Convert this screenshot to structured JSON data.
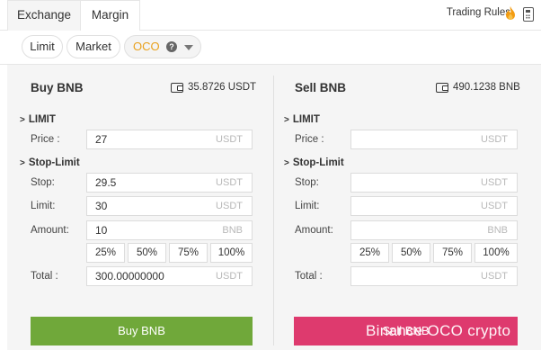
{
  "tabs": {
    "exchange": "Exchange",
    "margin": "Margin"
  },
  "header": {
    "trading_rules": "Trading Rules"
  },
  "order_types": {
    "limit": "Limit",
    "market": "Market",
    "oco": "OCO",
    "help": "?"
  },
  "buy": {
    "title": "Buy BNB",
    "balance": "35.8726 USDT",
    "limit_section": "LIMIT",
    "price_label": "Price :",
    "price_value": "27",
    "price_unit": "USDT",
    "stop_limit_section": "Stop-Limit",
    "stop_label": "Stop:",
    "stop_value": "29.5",
    "stop_unit": "USDT",
    "limit_label": "Limit:",
    "limit_value": "30",
    "limit_unit": "USDT",
    "amount_label": "Amount:",
    "amount_value": "10",
    "amount_unit": "BNB",
    "percentages": [
      "25%",
      "50%",
      "75%",
      "100%"
    ],
    "total_label": "Total :",
    "total_value": "300.00000000",
    "total_unit": "USDT",
    "button": "Buy BNB"
  },
  "sell": {
    "title": "Sell BNB",
    "balance": "490.1238 BNB",
    "limit_section": "LIMIT",
    "price_label": "Price :",
    "price_unit": "USDT",
    "stop_limit_section": "Stop-Limit",
    "stop_label": "Stop:",
    "stop_unit": "USDT",
    "limit_label": "Limit:",
    "limit_unit": "USDT",
    "amount_label": "Amount:",
    "amount_unit": "BNB",
    "percentages": [
      "25%",
      "50%",
      "75%",
      "100%"
    ],
    "total_label": "Total :",
    "total_unit": "USDT",
    "button": "Sell BNB"
  },
  "watermark": "Binance OCO crypto",
  "colors": {
    "buy": "#70a83a",
    "sell": "#de3a6e",
    "oco_accent": "#e9a11d",
    "fire": "#f39c12"
  },
  "icons": {
    "fire": "fire-icon",
    "calculator": "calculator-icon",
    "wallet": "wallet-icon",
    "help": "help-icon",
    "caret": "caret-down-icon",
    "chevron": "chevron-right-icon"
  }
}
